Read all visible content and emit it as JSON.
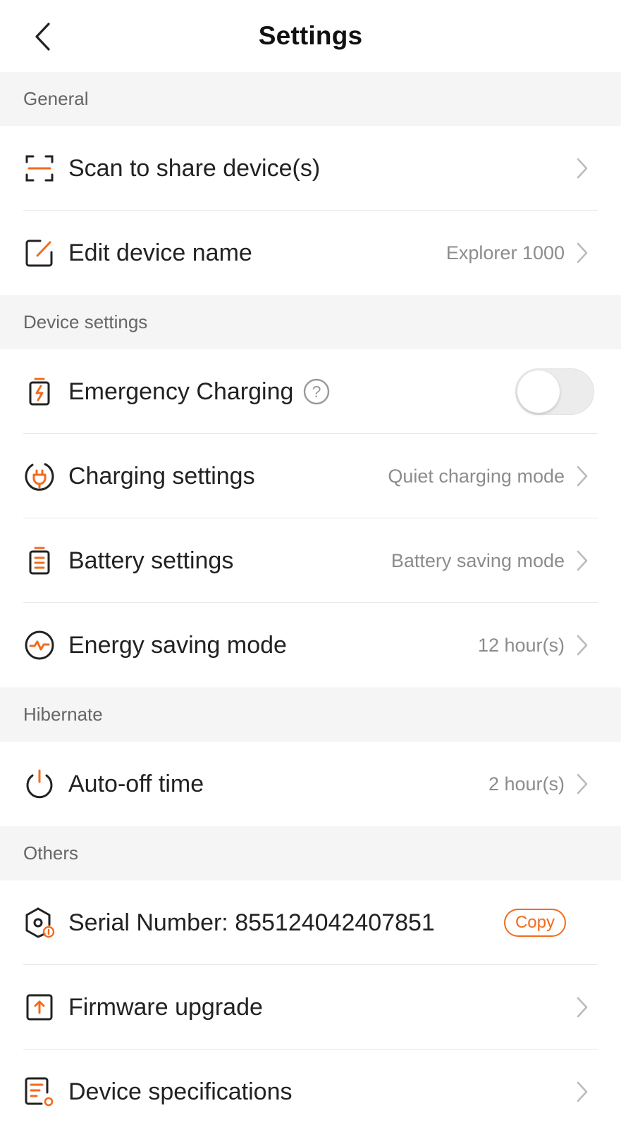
{
  "header": {
    "title": "Settings"
  },
  "colors": {
    "accent": "#f26b1d",
    "section_bg": "#f5f5f5",
    "toggle_off": "#ececec"
  },
  "sections": {
    "general": {
      "title": "General",
      "scan_share": {
        "label": "Scan to share device(s)",
        "icon": "qr-scan-icon"
      },
      "edit_name": {
        "label": "Edit device name",
        "value": "Explorer 1000",
        "icon": "edit-icon"
      }
    },
    "device_settings": {
      "title": "Device settings",
      "emergency_charging": {
        "label": "Emergency Charging",
        "icon": "emergency-battery-icon",
        "enabled": false
      },
      "charging_settings": {
        "label": "Charging settings",
        "value": "Quiet charging mode",
        "icon": "charging-plug-icon"
      },
      "battery_settings": {
        "label": "Battery settings",
        "value": "Battery saving mode",
        "icon": "battery-icon"
      },
      "energy_saving": {
        "label": "Energy saving mode",
        "value": "12 hour(s)",
        "icon": "pulse-icon"
      }
    },
    "hibernate": {
      "title": "Hibernate",
      "auto_off": {
        "label": "Auto-off time",
        "value": "2 hour(s)",
        "icon": "power-icon"
      }
    },
    "others": {
      "title": "Others",
      "serial": {
        "label": "Serial Number: 855124042407851",
        "copy_label": "Copy",
        "icon": "serial-icon"
      },
      "firmware": {
        "label": "Firmware upgrade",
        "icon": "upgrade-icon"
      },
      "specs": {
        "label": "Device specifications",
        "icon": "specs-icon"
      }
    }
  }
}
